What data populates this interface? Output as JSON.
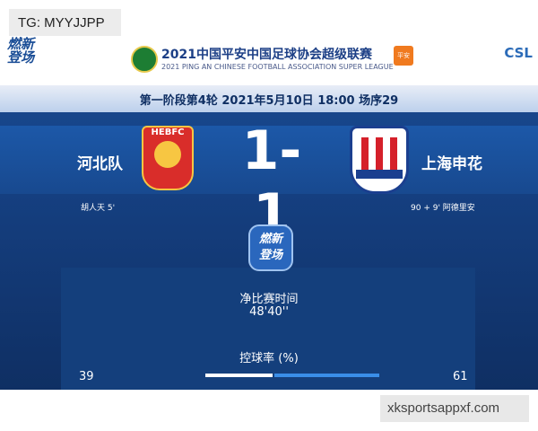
{
  "overlay": {
    "top_left_tag": "TG: MYYJJPP",
    "bottom_right_tag": "xksportsappxf.com"
  },
  "header": {
    "logo_left": "燃新\n登场",
    "logo_right": "CSL",
    "league_title_cn": "2021中国平安中国足球协会超级联赛",
    "league_title_en": "2021 PING AN CHINESE FOOTBALL ASSOCIATION SUPER LEAGUE"
  },
  "match": {
    "stage_info": "第一阶段第4轮  2021年5月10日  18:00  场序29",
    "home_team": "河北队",
    "away_team": "上海申花",
    "home_crest_text": "HEBFC",
    "score": "1-1",
    "home_scorer": "胡人天  5'",
    "away_scorer": "90 + 9'  阿德里安"
  },
  "stats": {
    "center_logo": "燃新\n登场",
    "net_time_label": "净比赛时间",
    "net_time_value": "48'40''",
    "possession_label": "控球率 (%)",
    "possession_home": "39",
    "possession_away": "61",
    "possession_home_value": 39,
    "possession_away_value": 61
  },
  "colors": {
    "primary_blue": "#1a4d96",
    "home_red": "#d92d2a",
    "away_blue": "#3a8ee8"
  }
}
